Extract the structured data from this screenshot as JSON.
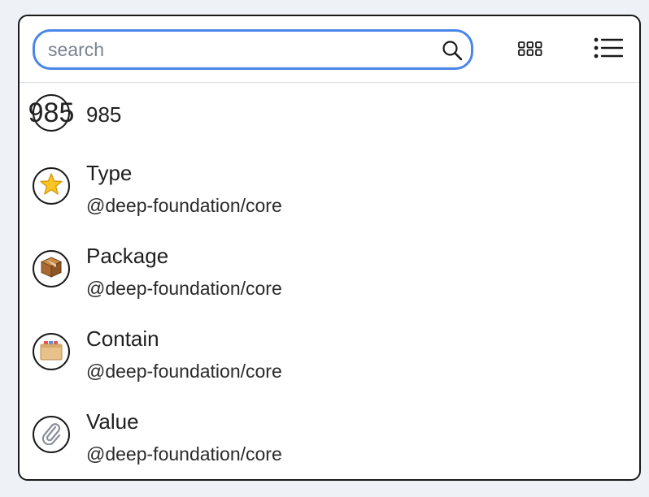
{
  "search": {
    "placeholder": "search",
    "value": "",
    "icon": "search-icon"
  },
  "toolbar": {
    "grid_icon": "grid-view-icon",
    "list_icon": "list-view-icon"
  },
  "items": [
    {
      "avatar_text": "985",
      "title": "985",
      "subtitle": ""
    },
    {
      "avatar_icon": "star-icon",
      "title": "Type",
      "subtitle": "@deep-foundation/core"
    },
    {
      "avatar_icon": "package-box-icon",
      "title": "Package",
      "subtitle": "@deep-foundation/core"
    },
    {
      "avatar_icon": "file-box-icon",
      "title": "Contain",
      "subtitle": "@deep-foundation/core"
    },
    {
      "avatar_icon": "paperclip-icon",
      "title": "Value",
      "subtitle": "@deep-foundation/core"
    }
  ],
  "colors": {
    "accent": "#4a86e8",
    "border": "#1a1a1a",
    "background": "#eef1f6"
  }
}
